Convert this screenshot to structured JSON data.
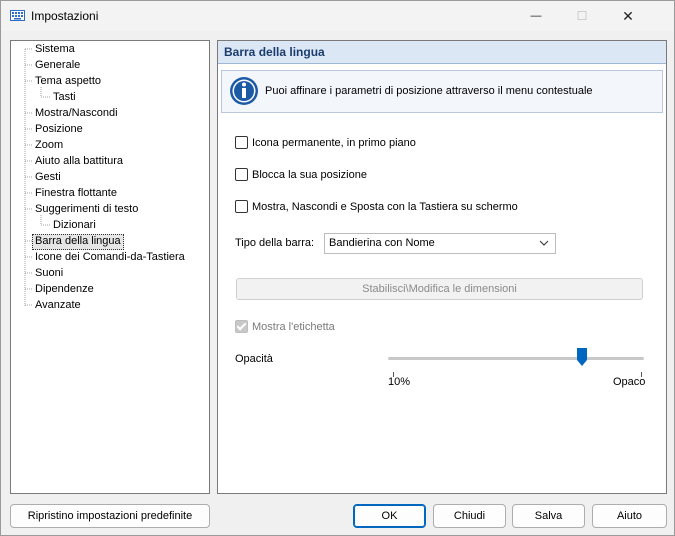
{
  "window": {
    "title": "Impostazioni",
    "minimize_glyph": "—",
    "maximize_glyph": "☐",
    "close_glyph": "✕"
  },
  "tree": {
    "items": [
      {
        "label": "Sistema",
        "level": 0
      },
      {
        "label": "Generale",
        "level": 0
      },
      {
        "label": "Tema aspetto",
        "level": 0
      },
      {
        "label": "Tasti",
        "level": 1
      },
      {
        "label": "Mostra/Nascondi",
        "level": 0
      },
      {
        "label": "Posizione",
        "level": 0
      },
      {
        "label": "Zoom",
        "level": 0
      },
      {
        "label": "Aiuto alla battitura",
        "level": 0
      },
      {
        "label": "Gesti",
        "level": 0
      },
      {
        "label": "Finestra flottante",
        "level": 0
      },
      {
        "label": "Suggerimenti di testo",
        "level": 0
      },
      {
        "label": "Dizionari",
        "level": 1
      },
      {
        "label": "Barra della lingua",
        "level": 0,
        "selected": true
      },
      {
        "label": "Icone dei Comandi-da-Tastiera",
        "level": 0
      },
      {
        "label": "Suoni",
        "level": 0
      },
      {
        "label": "Dipendenze",
        "level": 0
      },
      {
        "label": "Avanzate",
        "level": 0
      }
    ]
  },
  "panel": {
    "title": "Barra della lingua",
    "info_text": "Puoi affinare i parametri di posizione attraverso il menu contestuale",
    "checkboxes": [
      {
        "label": "Icona permanente, in primo piano",
        "checked": false
      },
      {
        "label": "Blocca la sua posizione",
        "checked": false
      },
      {
        "label": "Mostra, Nascondi e Sposta con la Tastiera su schermo",
        "checked": false
      }
    ],
    "bar_type_label": "Tipo della barra:",
    "bar_type_value": "Bandierina con Nome",
    "resize_button": "Stabilisci\\Modifica le dimensioni",
    "show_label_checkbox": {
      "label": "Mostra l'etichetta",
      "checked": true,
      "disabled": true
    },
    "opacity_label": "Opacità",
    "opacity_min_label": "10%",
    "opacity_max_label": "Opaco",
    "opacity_value": 0.77
  },
  "buttons": {
    "reset": "Ripristino impostazioni predefinite",
    "ok": "OK",
    "close": "Chiudi",
    "save": "Salva",
    "help": "Aiuto"
  },
  "colors": {
    "accent": "#0067c0",
    "header_bg": "#dce7f5",
    "header_text": "#1a3c6e",
    "info_icon": "#1c5aa6"
  }
}
